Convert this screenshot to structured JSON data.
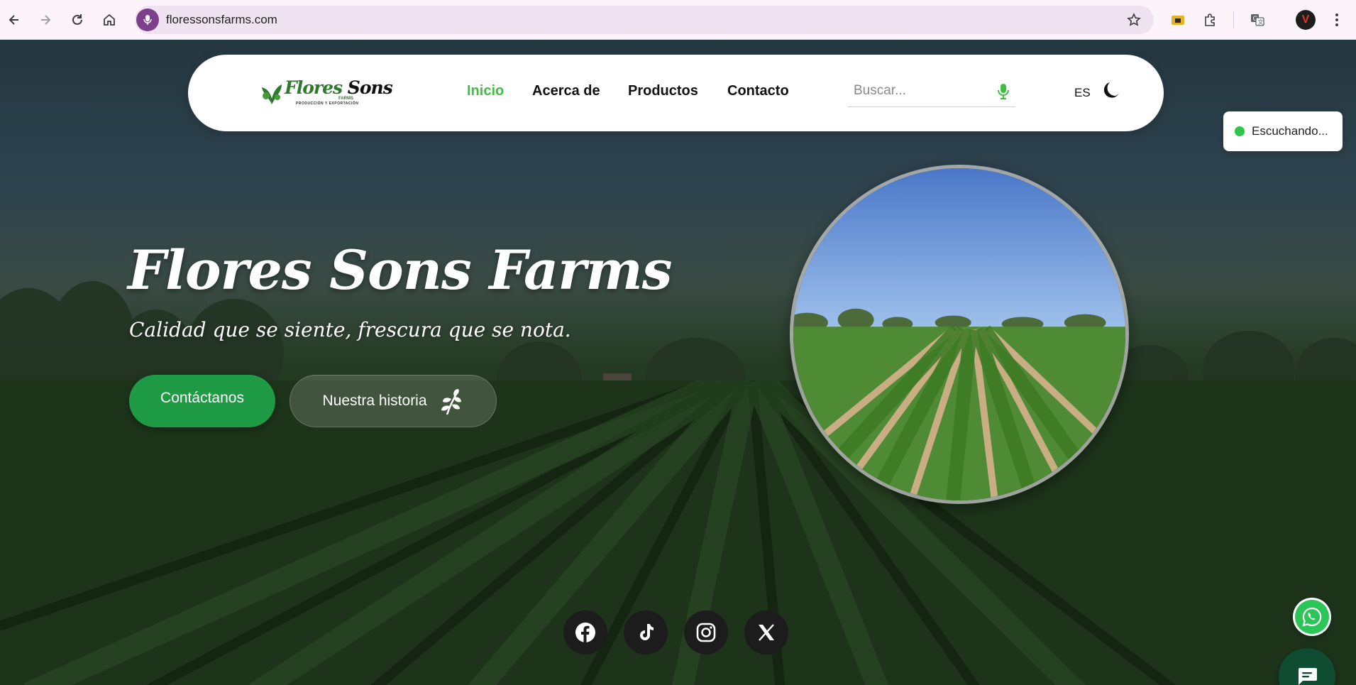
{
  "browser": {
    "url": "floressonsfarms.com",
    "profile_initial": "V",
    "icons": [
      "back-icon",
      "forward-icon",
      "reload-icon",
      "home-icon",
      "mic-icon",
      "star-icon",
      "extension-folder-icon",
      "puzzle-icon",
      "translate-icon",
      "menu-icon"
    ]
  },
  "navbar": {
    "logo_main": "Flores",
    "logo_sons": "Sons",
    "logo_farms": "FARMS",
    "logo_sub": "PRODUCCIÓN Y EXPORTACIÓN",
    "links": [
      {
        "label": "Inicio",
        "active": true
      },
      {
        "label": "Acerca de",
        "active": false
      },
      {
        "label": "Productos",
        "active": false
      },
      {
        "label": "Contacto",
        "active": false
      }
    ],
    "search_placeholder": "Buscar...",
    "language": "ES"
  },
  "listening": {
    "label": "Escuchando...",
    "color": "#2ec54a"
  },
  "hero": {
    "title": "Flores Sons Farms",
    "tagline": "Calidad que se siente, frescura que se nota.",
    "primary_button": "Contáctanos",
    "secondary_button": "Nuestra historia"
  },
  "social": [
    "facebook-icon",
    "tiktok-icon",
    "instagram-icon",
    "x-icon"
  ],
  "colors": {
    "accent_green": "#1f9a45",
    "active_link": "#3fbf3f",
    "chat_button": "#0f4d32",
    "whatsapp": "#2cc557"
  }
}
